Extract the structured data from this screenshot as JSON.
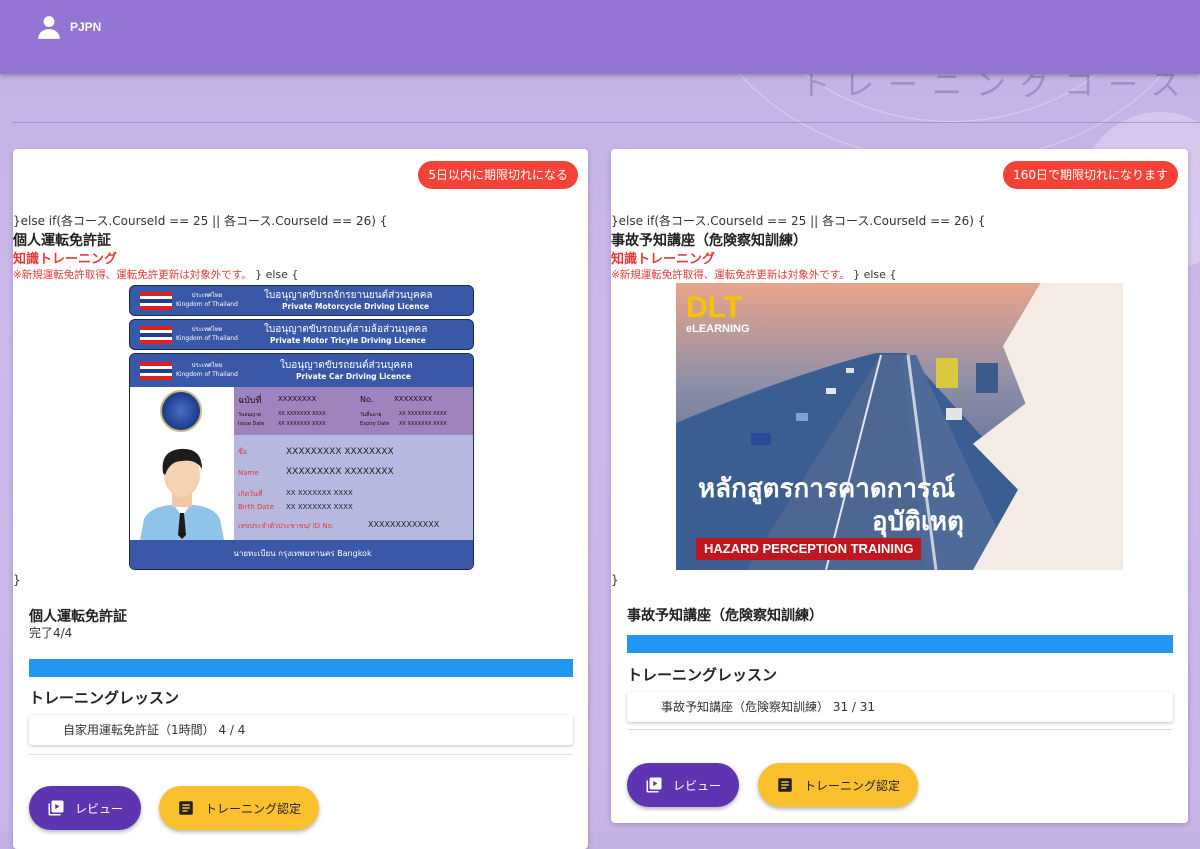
{
  "header": {
    "username": "PJPN"
  },
  "page": {
    "title_fragment": "トレーニングコース"
  },
  "cards": [
    {
      "expiry": "5日以内に期限切れになる",
      "code_line": "}else if(各コース.CourseId == 25 || 各コース.CourseId == 26) {",
      "title": "個人運転免許証",
      "subtitle": "知識トレーニング",
      "note": "※新規運転免許取得、運転免許更新は対象外です。",
      "note_tail": "} else {",
      "brace": "}",
      "section_title": "個人運転免許証",
      "section_sub": "完了4/4",
      "progress": 1.0,
      "lessons_title": "トレーニングレッスン",
      "lesson": "自家用運転免許証（1時間） 4 / 4",
      "review_label": "レビュー",
      "cert_label": "トレーニング認定",
      "license": {
        "strips": [
          {
            "th": "ใบอนุญาตขับรถจักรยานยนต์ส่วนบุคคล",
            "en": "Private Motorcycle Driving Licence"
          },
          {
            "th": "ใบอนุญาตขับรถยนต์สามล้อส่วนบุคคล",
            "en": "Private Motor Tricyle Driving Licence"
          },
          {
            "th": "ใบอนุญาตขับรถยนต์ส่วนบุคคล",
            "en": "Private Car Driving Licence"
          }
        ],
        "country_th": "ประเทศไทย",
        "country_en": "Kingdom of Thailand",
        "no_th": "ฉบับที่",
        "no_val": "XXXXXXXX",
        "no_en": "No.",
        "no_val2": "XXXXXXXX",
        "issue_th": "วันอนุญาต",
        "issue_en": "Issue Date",
        "issue_val": "XX XXXXXXX XXXX",
        "expiry_th": "วันสิ้นอายุ",
        "expiry_en": "Expiry Date",
        "expiry_val": "XX XXXXXXX XXXX",
        "name_th": "ชื่อ",
        "name_th_val": "XXXXXXXXX  XXXXXXXX",
        "name_en": "Name",
        "name_en_val": "XXXXXXXXX  XXXXXXXX",
        "birth_th": "เกิดวันที่",
        "birth_th_val": "XX XXXXXXX XXXX",
        "birth_en": "Birth Date",
        "birth_en_val": "XX XXXXXXX XXXX",
        "id_label": "เลขประจำตัวประชาชน/ ID No.",
        "id_val": "XXXXXXXXXXXXX",
        "footer": "นายทะเบียน กรุงเทพมหานคร Bangkok"
      }
    },
    {
      "expiry": "160日で期限切れになります",
      "code_line": "}else if(各コース.CourseId == 25 || 各コース.CourseId == 26) {",
      "title": "事故予知講座（危険察知訓練）",
      "subtitle": "知識トレーニング",
      "note": "※新規運転免許取得、運転免許更新は対象外です。",
      "note_tail": "} else {",
      "brace": "}",
      "section_title": "事故予知講座（危険察知訓練）",
      "progress": 1.0,
      "lessons_title": "トレーニングレッスン",
      "lesson": "事故予知講座（危険察知訓練） 31 / 31",
      "review_label": "レビュー",
      "cert_label": "トレーニング認定",
      "hazard": {
        "logo": "DLT",
        "logo_sub": "eLEARNING",
        "th_line1": "หลักสูตรการคาดการณ์",
        "th_line2": "อุบัติเหตุ",
        "banner": "HAZARD PERCEPTION TRAINING"
      }
    }
  ],
  "colors": {
    "header": "#9475d3",
    "expiry_badge": "#f44336",
    "progress": "#2196f3",
    "review_button": "#5e35b1",
    "cert_button": "#fbc02d",
    "accent_red": "#e53935"
  }
}
